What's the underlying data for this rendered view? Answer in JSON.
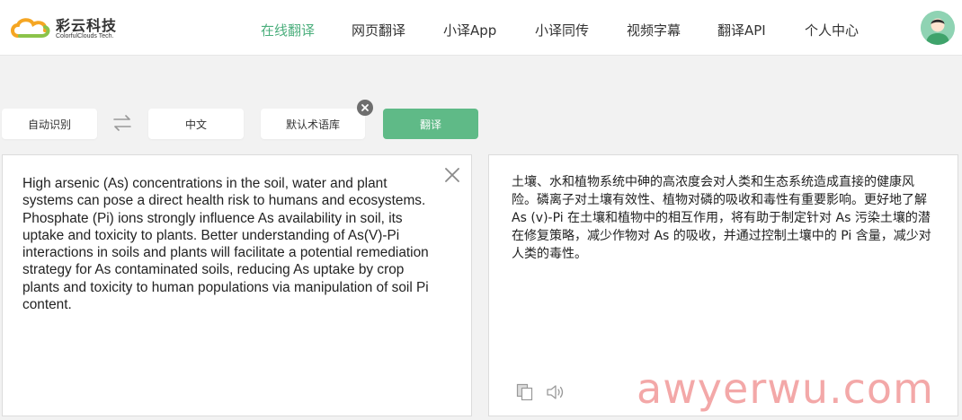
{
  "brand": {
    "name_cn": "彩云科技",
    "name_en": "ColorfulClouds Tech."
  },
  "nav": {
    "items": [
      {
        "label": "在线翻译",
        "active": true
      },
      {
        "label": "网页翻译",
        "active": false
      },
      {
        "label": "小译App",
        "active": false
      },
      {
        "label": "小译同传",
        "active": false
      },
      {
        "label": "视频字幕",
        "active": false
      },
      {
        "label": "翻译API",
        "active": false
      },
      {
        "label": "个人中心",
        "active": false
      }
    ]
  },
  "controls": {
    "source_lang": "自动识别",
    "target_lang": "中文",
    "glossary": "默认术语库",
    "translate": "翻译"
  },
  "source": {
    "text": "High arsenic (As) concentrations in the soil, water and plant systems can pose a direct health risk to humans and ecosystems. Phosphate (Pi) ions strongly influence As availability in soil, its uptake and toxicity to plants. Better understanding of As(V)-Pi interactions in soils and plants will facilitate a potential remediation strategy for As contaminated soils, reducing As uptake by crop plants and toxicity to human populations via manipulation of soil Pi content."
  },
  "target": {
    "text": "土壤、水和植物系统中砷的高浓度会对人类和生态系统造成直接的健康风险。磷离子对土壤有效性、植物对磷的吸收和毒性有重要影响。更好地了解 As (v)-Pi 在土壤和植物中的相互作用，将有助于制定针对 As 污染土壤的潜在修复策略，减少作物对 As 的吸收，并通过控制土壤中的 Pi 含量，减少对人类的毒性。"
  },
  "watermark": "awyerwu.com",
  "colors": {
    "accent": "#5fba87",
    "nav_active": "#4caf7d",
    "watermark": "#f3a4a4"
  },
  "icons": {
    "swap": "swap-arrows-icon",
    "remove_glossary": "close-circle-icon",
    "clear_source": "close-icon",
    "copy": "copy-icon",
    "speaker": "speaker-icon"
  }
}
